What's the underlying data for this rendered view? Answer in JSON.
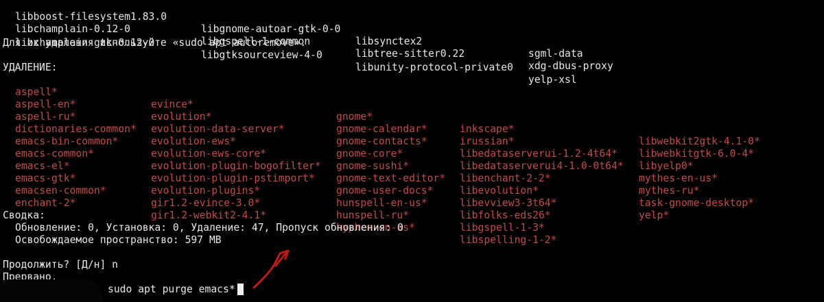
{
  "top_packages": [
    [
      "libboost-filesystem1.83.0",
      "libgnome-autoar-gtk-0-0",
      "libsynctex2",
      "sgml-data"
    ],
    [
      "libchamplain-0.12-0",
      "libgspell-1-common",
      "libtree-sitter0.22",
      "xdg-dbus-proxy"
    ],
    [
      "libchamplain-gtk-0.12-0",
      "libgtksourceview-4-0",
      "libunity-protocol-private0",
      "yelp-xsl"
    ]
  ],
  "autoremove_hint": "Для их удаления используйте «sudo apt autoremove».",
  "removal_header": "УДАЛЕНИЕ:",
  "removal_columns": [
    [
      "aspell*",
      "aspell-en*",
      "aspell-ru*",
      "dictionaries-common*",
      "emacs-bin-common*",
      "emacs-common*",
      "emacs-el*",
      "emacs-gtk*",
      "emacsen-common*",
      "enchant-2*"
    ],
    [
      "evince*",
      "evolution*",
      "evolution-data-server*",
      "evolution-ews*",
      "evolution-ews-core*",
      "evolution-plugin-bogofilter*",
      "evolution-plugin-pstimport*",
      "evolution-plugins*",
      "gir1.2-evince-3.0*",
      "gir1.2-webkit2-4.1*"
    ],
    [
      "gnome*",
      "gnome-calendar*",
      "gnome-contacts*",
      "gnome-core*",
      "gnome-sushi*",
      "gnome-text-editor*",
      "gnome-user-docs*",
      "hunspell-en-us*",
      "hunspell-ru*",
      "hyphen-en-us*"
    ],
    [
      "inkscape*",
      "irussian*",
      "libedataserverui-1.2-4t64*",
      "libedataserverui4-1.0-0t64*",
      "libenchant-2-2*",
      "libevolution*",
      "libevview3-3t64*",
      "libfolks-eds26*",
      "libgspell-1-3*",
      "libspelling-1-2*"
    ],
    [
      "libwebkit2gtk-4.1-0*",
      "libwebkitgtk-6.0-4*",
      "libyelp0*",
      "mythes-en-us*",
      "mythes-ru*",
      "task-gnome-desktop*",
      "yelp*"
    ]
  ],
  "summary": {
    "header": "Сводка:",
    "counts": "Обновление: 0, Установка: 0, Удаление: 47, Пропуск обновления: 0",
    "space": "Освобождаемое пространство: 597 MB"
  },
  "prompt": {
    "question": "Продолжить? [Д/н] n",
    "aborted": "Прервано.",
    "command": "sudo apt purge emacs*"
  },
  "colors": {
    "background": "#000000",
    "text": "#e8e8e8",
    "removal_text": "#c24a4a",
    "annotation_arrow": "#c21a1a"
  }
}
